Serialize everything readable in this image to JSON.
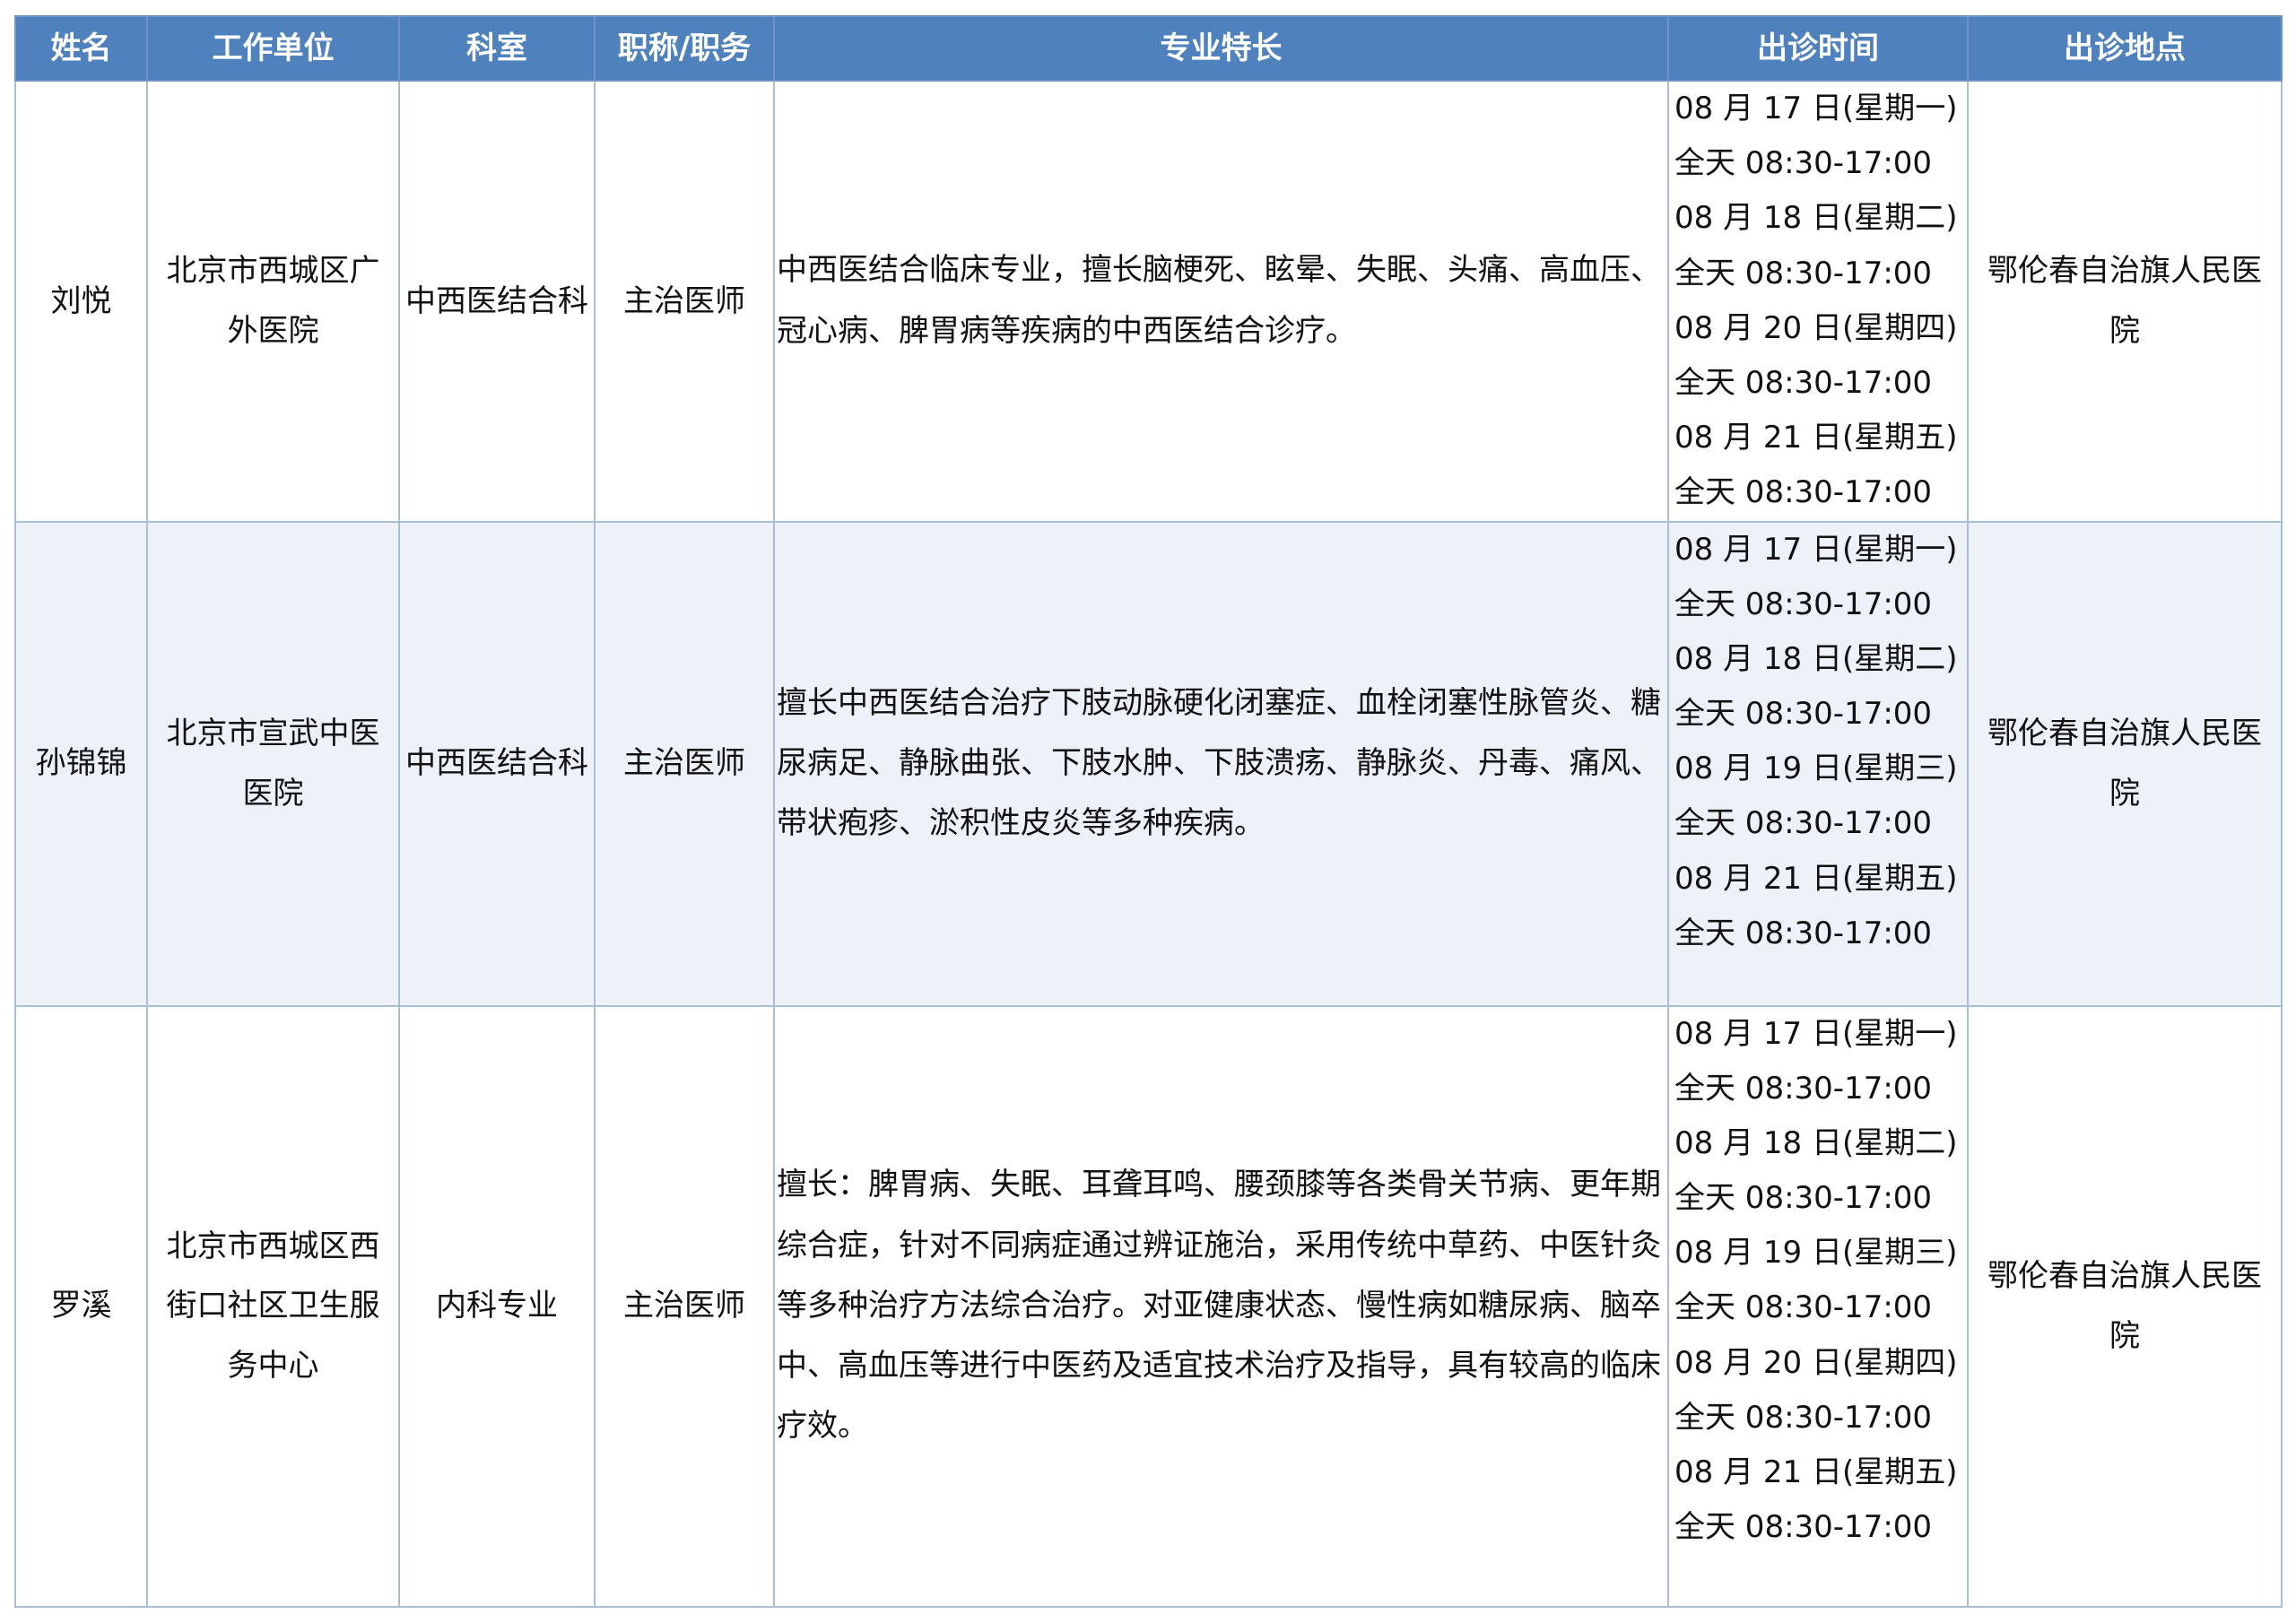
{
  "headers": {
    "name": "姓名",
    "unit": "工作单位",
    "dept": "科室",
    "title": "职称/职务",
    "specialty": "专业特长",
    "time": "出诊时间",
    "location": "出诊地点"
  },
  "doctors": [
    {
      "name": "刘悦",
      "unit": "北京市西城区广外医院",
      "dept": "中西医结合科",
      "title": "主治医师",
      "specialty": "中西医结合临床专业，擅长脑梗死、眩晕、失眠、头痛、高血压、冠心病、脾胃病等疾病的中西医结合诊疗。",
      "schedule": [
        "08 月 17 日(星期一)",
        "全天 08:30-17:00",
        "08 月 18 日(星期二)",
        "全天 08:30-17:00",
        "08 月 20 日(星期四)",
        "全天 08:30-17:00",
        "08 月 21 日(星期五)",
        "全天 08:30-17:00"
      ],
      "location": "鄂伦春自治旗人民医院"
    },
    {
      "name": "孙锦锦",
      "unit": "北京市宣武中医医院",
      "dept": "中西医结合科",
      "title": "主治医师",
      "specialty": "擅长中西医结合治疗下肢动脉硬化闭塞症、血栓闭塞性脉管炎、糖尿病足、静脉曲张、下肢水肿、下肢溃疡、静脉炎、丹毒、痛风、带状疱疹、淤积性皮炎等多种疾病。",
      "schedule": [
        "08 月 17 日(星期一)",
        "全天 08:30-17:00",
        "08 月 18 日(星期二)",
        "全天 08:30-17:00",
        "08 月 19 日(星期三)",
        "全天 08:30-17:00",
        "08 月 21 日(星期五)",
        "全天 08:30-17:00"
      ],
      "location": "鄂伦春自治旗人民医院"
    },
    {
      "name": "罗溪",
      "unit": "北京市西城区西街口社区卫生服务中心",
      "dept": "内科专业",
      "title": "主治医师",
      "specialty": "擅长：脾胃病、失眠、耳聋耳鸣、腰颈膝等各类骨关节病、更年期综合症，针对不同病症通过辨证施治，采用传统中草药、中医针灸等多种治疗方法综合治疗。对亚健康状态、慢性病如糖尿病、脑卒中、高血压等进行中医药及适宜技术治疗及指导，具有较高的临床疗效。",
      "schedule": [
        "08 月 17 日(星期一)",
        "全天 08:30-17:00",
        "08 月 18 日(星期二)",
        "全天 08:30-17:00",
        "08 月 19 日(星期三)",
        "全天 08:30-17:00",
        "08 月 20 日(星期四)",
        "全天 08:30-17:00",
        "08 月 21 日(星期五)",
        "全天 08:30-17:00"
      ],
      "location": "鄂伦春自治旗人民医院"
    }
  ]
}
